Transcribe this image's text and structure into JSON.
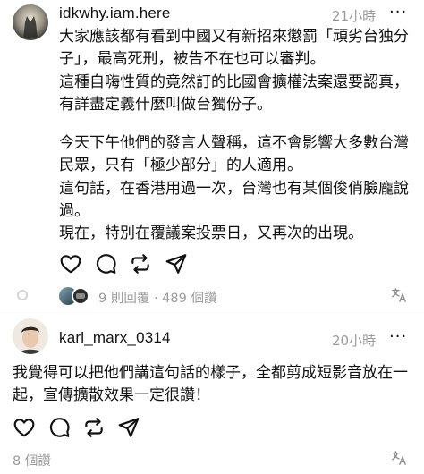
{
  "post1": {
    "username": "idkwhy.iam.here",
    "timestamp": "21小時",
    "more": "···",
    "paragraphs": [
      "大家應該都有看到中國又有新招來懲罰「頑劣台独分子」，最高死刑，被告不在也可以審判。",
      "這種自嗨性質的竟然訂的比國會擴權法案還要認真，有詳盡定義什麼叫做台獨份子。",
      "今天下午他們的發言人聲稱，這不會影響大多數台灣民眾，只有「極少部分」的人適用。",
      "這句話，在香港用過一次，台灣也有某個俊俏臉龐說過。",
      "現在，特別在覆議案投票日，又再次的出現。"
    ],
    "replies": "9 則回覆",
    "separator": "·",
    "views": "489 個讚",
    "translate_icon": "translate-icon"
  },
  "post2": {
    "username": "karl_marx_0314",
    "timestamp": "20小時",
    "more": "···",
    "paragraphs": [
      "我覺得可以把他們講這句話的樣子，全都剪成短影音放在一起，宣傳擴散效果一定很讚！"
    ],
    "views": "8 個讚",
    "translate_icon": "translate-icon"
  }
}
